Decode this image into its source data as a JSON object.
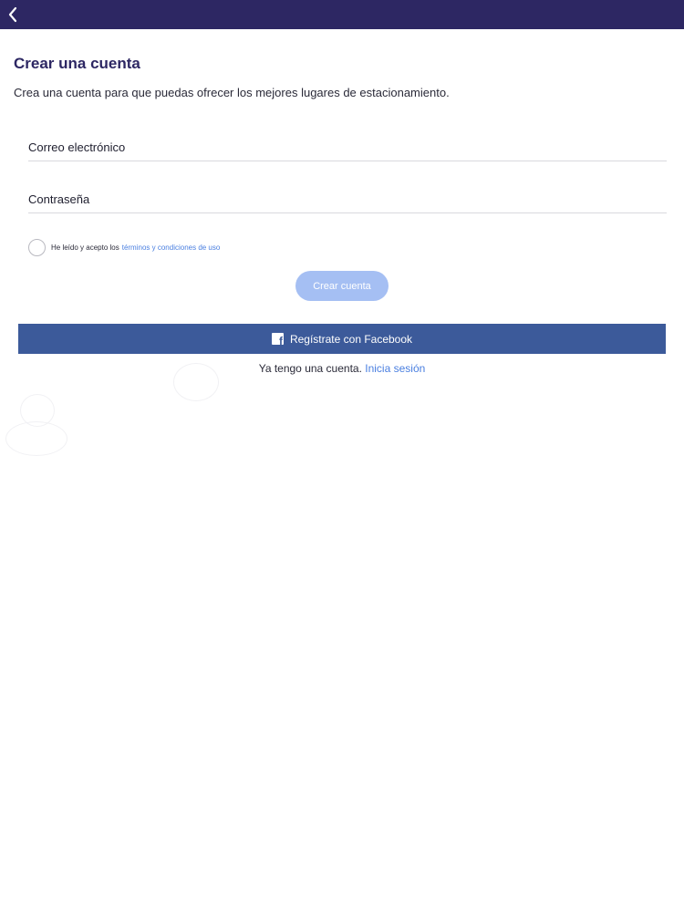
{
  "header": {
    "back_icon": "chevron-left-icon",
    "background": "#2d2763"
  },
  "page": {
    "title": "Crear una cuenta",
    "subtitle": "Crea una cuenta para que puedas ofrecer los mejores lugares de estacionamiento."
  },
  "form": {
    "email_placeholder": "Correo electrónico",
    "email_value": "",
    "password_placeholder": "Contraseña",
    "password_value": "",
    "terms_text": "He leído y acepto los",
    "terms_link": "términos y condiciones de uso",
    "terms_checked": false,
    "submit_label": "Crear cuenta"
  },
  "facebook": {
    "label": "Regístrate con Facebook",
    "icon": "facebook-icon",
    "color": "#3c5a9a"
  },
  "login": {
    "prompt": "Ya tengo una cuenta.",
    "link": "Inicia sesión"
  },
  "colors": {
    "accent": "#2d2763",
    "link": "#4a7fe0",
    "button_disabled": "#a5bff3"
  }
}
